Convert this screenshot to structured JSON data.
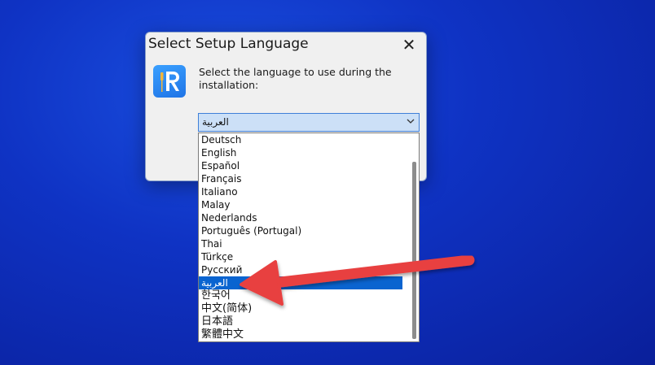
{
  "dialog": {
    "title": "Select Setup Language",
    "close_label": "✕",
    "prompt": "Select the language to use during the installation:"
  },
  "combo": {
    "selected": "العربية",
    "arrow": "⌵"
  },
  "dropdown": {
    "items": [
      "Deutsch",
      "English",
      "Español",
      "Français",
      "Italiano",
      "Malay",
      "Nederlands",
      "Português (Portugal)",
      "Thai",
      "Türkçe",
      "Русский",
      "العربية",
      "한국어",
      "中文(简体)",
      "日本語",
      "繁體中文"
    ],
    "selected_index": 11
  },
  "colors": {
    "desktop": "#0f33c4",
    "selection": "#0a64d0",
    "annotation_arrow": "#e8403f"
  }
}
